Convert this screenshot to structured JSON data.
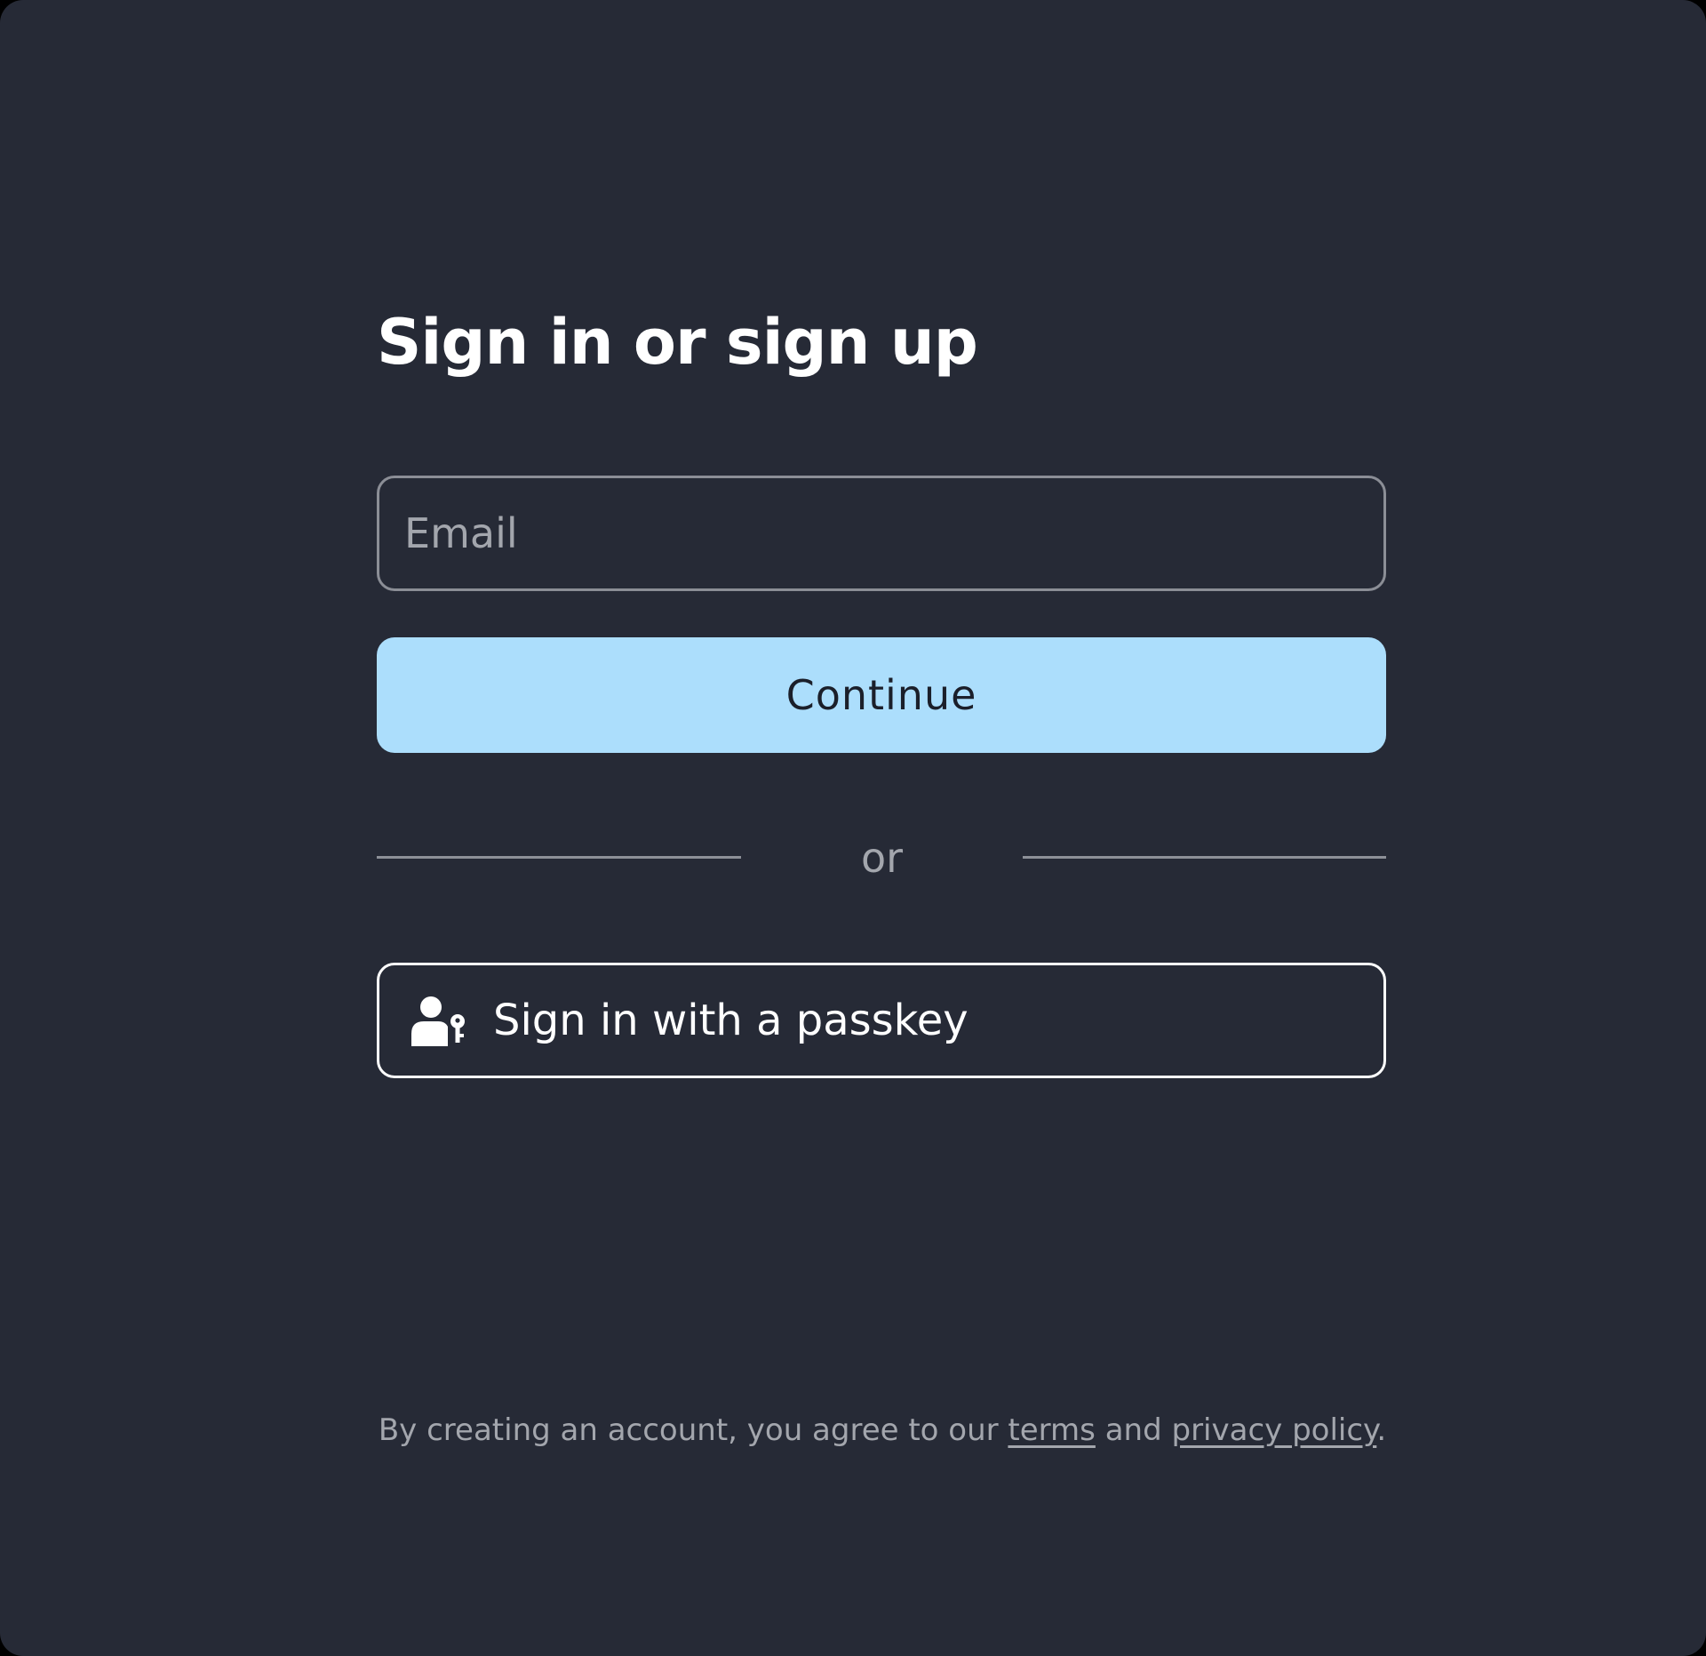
{
  "colors": {
    "background": "#262a36",
    "primary_button": "#acdefc",
    "text": "#ffffff",
    "muted_text": "#a3a6ad"
  },
  "auth": {
    "title": "Sign in or sign up",
    "email_placeholder": "Email",
    "email_value": "",
    "continue_label": "Continue",
    "divider_text": "or",
    "passkey_icon": "user-key-icon",
    "passkey_label": "Sign in with a passkey"
  },
  "footer": {
    "prefix": "By creating an account, you agree to our ",
    "terms_label": "terms",
    "conjunction": " and ",
    "privacy_label": "privacy policy",
    "suffix": "."
  }
}
